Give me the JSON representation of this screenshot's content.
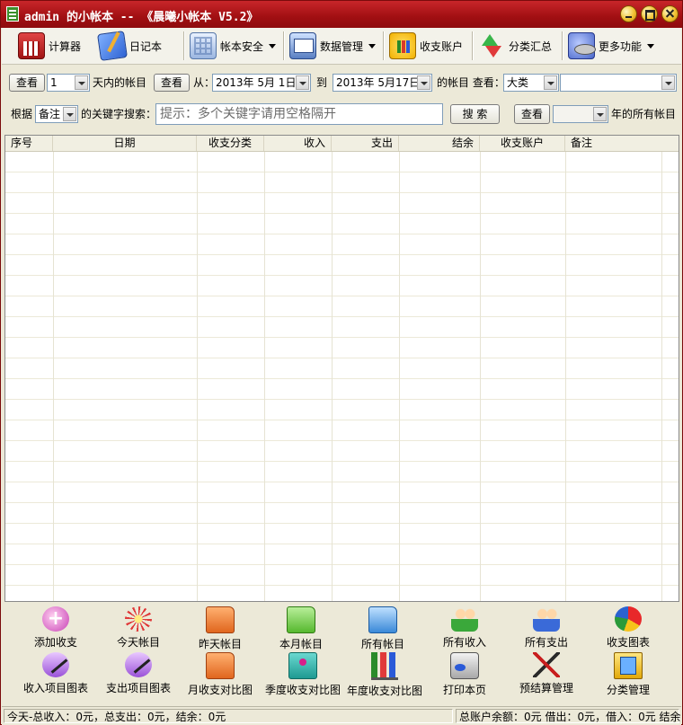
{
  "window": {
    "title": "admin 的小帐本 -- 《晨曦小帐本 V5.2》"
  },
  "toolbar": {
    "calculator": "计算器",
    "diary": "日记本",
    "security": "帐本安全",
    "data_mgmt": "数据管理",
    "accounts": "收支账户",
    "category_summary": "分类汇总",
    "more": "更多功能"
  },
  "query_row1": {
    "view_btn1": "查看",
    "days_value": "1",
    "days_label": "天内的帐目",
    "view_btn2": "查看",
    "from_label": "从：",
    "from_date": "2013年 5月 1日",
    "to_label": "到",
    "to_date": "2013年 5月17日",
    "items_label": "的帐目 查看：",
    "category_select": "大类",
    "subcategory_select": ""
  },
  "query_row2": {
    "by_label": "根据",
    "field_select": "备注",
    "keyword_label": "的关键字搜索：",
    "search_placeholder": "提示：多个关键字请用空格隔开",
    "search_btn": "搜 索",
    "view_btn": "查看",
    "year_select": "",
    "year_label": "年的所有帐目"
  },
  "table": {
    "columns": [
      "序号",
      "日期",
      "收支分类",
      "收入",
      "支出",
      "结余",
      "收支账户",
      "备注"
    ],
    "rows": []
  },
  "bottom_buttons_row1": [
    {
      "label": "添加收支",
      "icon": "add-entry-icon"
    },
    {
      "label": "今天帐目",
      "icon": "today-icon"
    },
    {
      "label": "昨天帐目",
      "icon": "yesterday-folder-icon"
    },
    {
      "label": "本月帐目",
      "icon": "month-folder-icon"
    },
    {
      "label": "所有帐目",
      "icon": "all-folder-icon"
    },
    {
      "label": "所有收入",
      "icon": "income-users-icon"
    },
    {
      "label": "所有支出",
      "icon": "expense-users-icon"
    },
    {
      "label": "收支图表",
      "icon": "pie-chart-icon"
    }
  ],
  "bottom_buttons_row2": [
    {
      "label": "收入项目图表",
      "icon": "income-chart-icon"
    },
    {
      "label": "支出项目图表",
      "icon": "expense-chart-icon"
    },
    {
      "label": "月收支对比图",
      "icon": "month-compare-icon"
    },
    {
      "label": "季度收支对比图",
      "icon": "quarter-compare-icon"
    },
    {
      "label": "年度收支对比图",
      "icon": "year-compare-icon"
    },
    {
      "label": "打印本页",
      "icon": "printer-icon"
    },
    {
      "label": "预结算管理",
      "icon": "settlement-icon"
    },
    {
      "label": "分类管理",
      "icon": "category-book-icon"
    }
  ],
  "status": {
    "left": "今天-总收入：0元，总支出：0元，结余：0元",
    "right": "总账户余额：0元 借出：0元，借入：0元 结余"
  }
}
